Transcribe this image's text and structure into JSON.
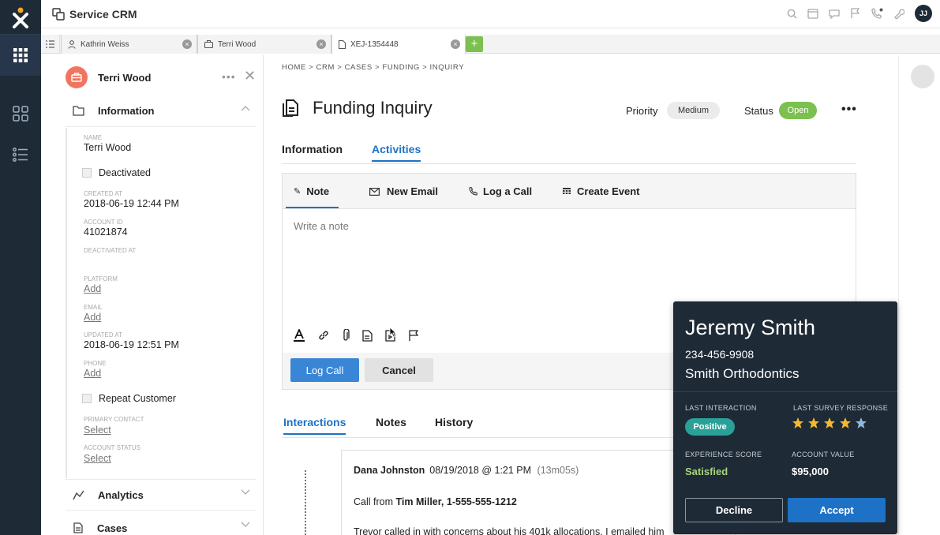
{
  "app": {
    "title": "Service CRM",
    "user_initials": "JJ",
    "colors": {
      "rail": "#1e2a36",
      "accent": "#1d72c6",
      "success": "#7cc04f",
      "case_icon": "#f07560"
    },
    "rail_items": [
      "apps-grid-icon",
      "dashboard-icon",
      "list-icon"
    ],
    "topbar_icons": [
      "search-icon",
      "calendar-icon",
      "chat-icon",
      "flag-icon",
      "phone-icon",
      "wrench-icon"
    ]
  },
  "tabs": [
    {
      "label": "Kathrin Weiss",
      "icon": "user-icon"
    },
    {
      "label": "Terri Wood",
      "icon": "briefcase-icon"
    },
    {
      "label": "XEJ-1354448",
      "icon": "document-icon"
    }
  ],
  "left_panel": {
    "title": "Terri Wood",
    "sections": {
      "information": "Information",
      "analytics": "Analytics",
      "cases": "Cases"
    },
    "fields": {
      "name_label": "NAME",
      "name_value": "Terri Wood",
      "deactivated": "Deactivated",
      "created_label": "CREATED AT",
      "created_value": "2018-06-19 12:44 PM",
      "account_id_label": "ACCOUNT ID",
      "account_id_value": "41021874",
      "deactivated_at_label": "DEACTIVATED AT",
      "platform_label": "PLATFORM",
      "platform_value": "Add",
      "email_label": "EMAIL",
      "email_value": "Add",
      "updated_label": "UPDATED AT",
      "updated_value": "2018-06-19 12:51 PM",
      "phone_label": "PHONE",
      "phone_value": "Add",
      "repeat_customer": "Repeat Customer",
      "primary_contact_label": "PRIMARY CONTACT",
      "primary_contact_value": "Select",
      "account_status_label": "ACCOUNT STATUS",
      "account_status_value": "Select"
    }
  },
  "main": {
    "breadcrumb": "HOME > CRM > CASES > FUNDING > INQUIRY",
    "title": "Funding Inquiry",
    "priority_label": "Priority",
    "priority_value": "Medium",
    "status_label": "Status",
    "status_value": "Open",
    "tabs": [
      "Information",
      "Activities"
    ],
    "composer": {
      "tabs": [
        "Note",
        "New Email",
        "Log a Call",
        "Create Event"
      ],
      "placeholder": "Write a note",
      "log_call": "Log Call",
      "cancel": "Cancel"
    },
    "sub_tabs": [
      "Interactions",
      "Notes",
      "History"
    ],
    "interaction": {
      "author": "Dana Johnston",
      "datetime": "08/19/2018 @ 1:21 PM",
      "duration": "(13m05s)",
      "call_prefix": "Call from",
      "caller": "Tim Miller, 1-555-555-1212",
      "body": "Trevor called in with concerns about his 401k allocations. I emailed him"
    }
  },
  "popup": {
    "name": "Jeremy Smith",
    "phone": "234-456-9908",
    "company": "Smith Orthodontics",
    "last_interaction_label": "LAST INTERACTION",
    "last_interaction_value": "Positive",
    "last_survey_label": "LAST SURVEY RESPONSE",
    "survey_rating": 4.5,
    "survey_max": 5,
    "experience_label": "EXPERIENCE SCORE",
    "experience_value": "Satisfied",
    "account_value_label": "ACCOUNT VALUE",
    "account_value": "$95,000",
    "decline": "Decline",
    "accept": "Accept"
  }
}
